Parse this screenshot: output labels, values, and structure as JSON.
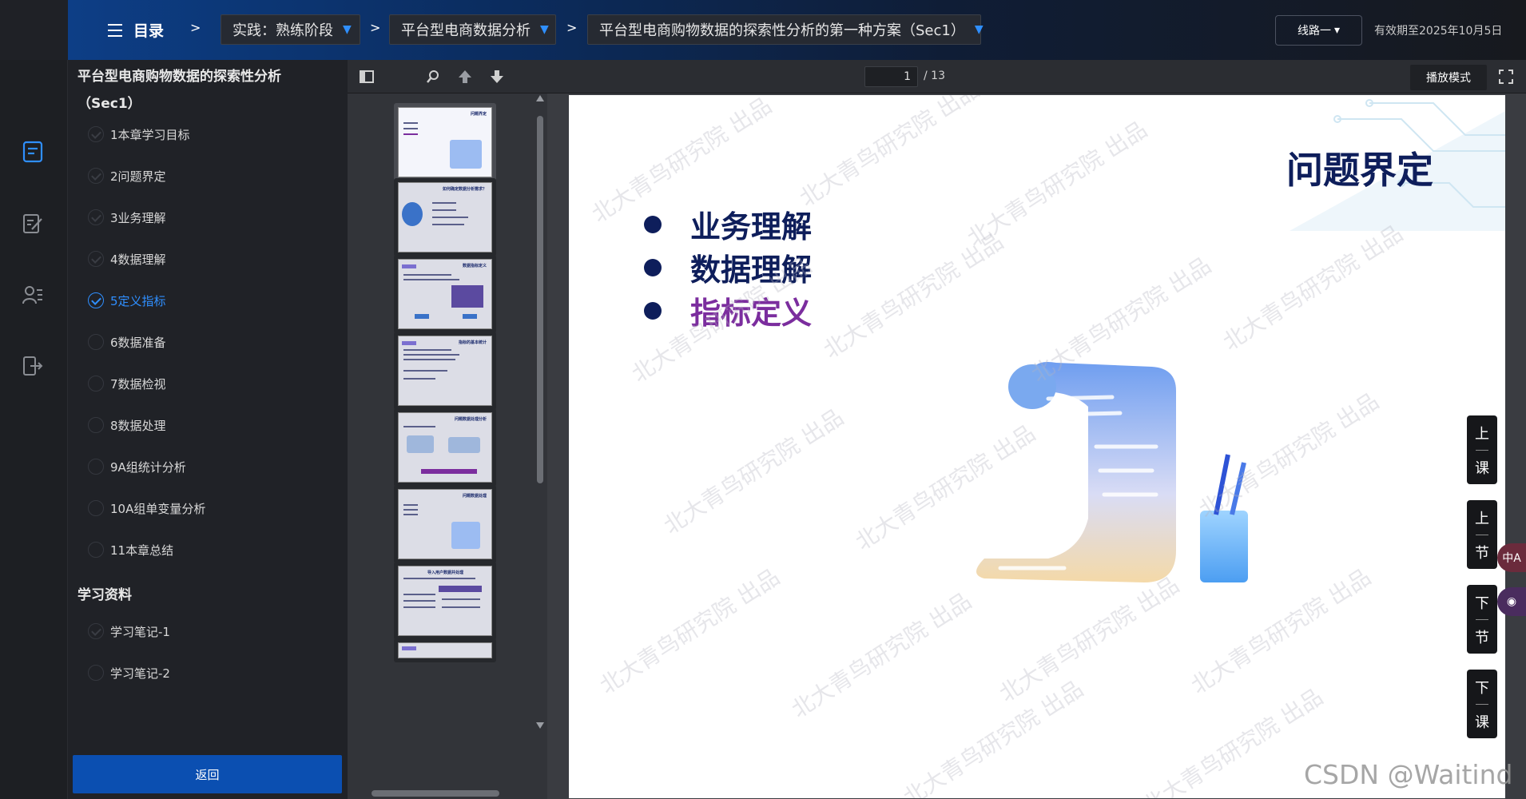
{
  "topbar": {
    "menu_label": "目录",
    "sep": ">",
    "crumbs": [
      "实践：熟练阶段",
      "平台型电商数据分析",
      "平台型电商购物数据的探索性分析的第一种方案（Sec1）"
    ],
    "caret": "▼",
    "route_label": "线路一",
    "route_caret": "▾",
    "valid_until": "有效期至2025年10月5日"
  },
  "toc": {
    "title": "平台型电商购物数据的探索性分析（Sec1）",
    "items": [
      {
        "label": "1本章学习目标",
        "state": "done"
      },
      {
        "label": "2问题界定",
        "state": "done"
      },
      {
        "label": "3业务理解",
        "state": "done"
      },
      {
        "label": "4数据理解",
        "state": "done"
      },
      {
        "label": "5定义指标",
        "state": "active"
      },
      {
        "label": "6数据准备",
        "state": "todo"
      },
      {
        "label": "7数据检视",
        "state": "todo"
      },
      {
        "label": "8数据处理",
        "state": "todo"
      },
      {
        "label": "9A组统计分析",
        "state": "todo"
      },
      {
        "label": "10A组单变量分析",
        "state": "todo"
      },
      {
        "label": "11本章总结",
        "state": "todo"
      }
    ],
    "materials_title": "学习资料",
    "materials": [
      {
        "label": "学习笔记-1",
        "state": "done"
      },
      {
        "label": "学习笔记-2",
        "state": "todo"
      }
    ],
    "back_label": "返回"
  },
  "pdf": {
    "current_page": "1",
    "total_pages": "/ 13",
    "play_mode": "播放模式",
    "thumb_titles": [
      "问题界定",
      "如何确定数据分析需求？",
      "数据指标定义",
      "指标的基本统计",
      "问题数据处理分析",
      "问题数据处理",
      "导入用户数据并处理"
    ]
  },
  "slide": {
    "title": "问题界定",
    "bullets": [
      "业务理解",
      "数据理解",
      "指标定义"
    ],
    "watermark": "北大青鸟研究院 出品"
  },
  "side_buttons": [
    [
      "上",
      "课"
    ],
    [
      "上",
      "节"
    ],
    [
      "下",
      "节"
    ],
    [
      "下",
      "课"
    ]
  ],
  "floaters": [
    "中A",
    "◉"
  ],
  "footer_mark": "CSDN @Waitind",
  "colors": {
    "accent": "#2f8fff",
    "title_navy": "#0e1e5b",
    "bullet_purple": "#7b2d9e",
    "back_button": "#0b4fb1"
  }
}
